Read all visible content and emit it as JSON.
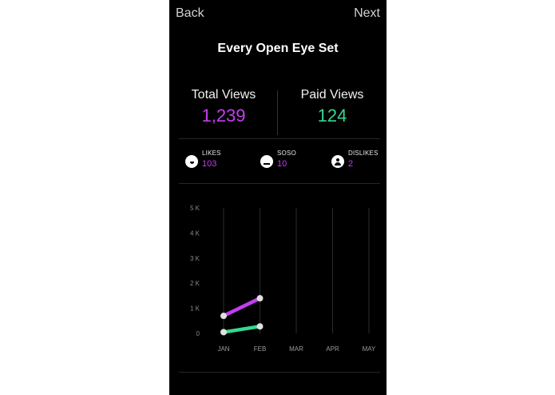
{
  "nav": {
    "back_label": "Back",
    "next_label": "Next"
  },
  "page": {
    "title": "Every Open Eye Set"
  },
  "stats": {
    "total_views_label": "Total Views",
    "total_views_value": "1,239",
    "paid_views_label": "Paid Views",
    "paid_views_value": "124"
  },
  "reactions": [
    {
      "label": "LIKES",
      "value": "103",
      "icon": "smile-face-icon"
    },
    {
      "label": "SOSO",
      "value": "10",
      "icon": "neutral-face-icon"
    },
    {
      "label": "DISLIKES",
      "value": "2",
      "icon": "person-face-icon"
    }
  ],
  "colors": {
    "purple": "#c33ef0",
    "green": "#35d88f",
    "background": "#000000"
  },
  "chart_data": {
    "type": "line",
    "categories": [
      "JAN",
      "FEB",
      "MAR",
      "APR",
      "MAY"
    ],
    "y_tick_labels": [
      "0",
      "1 K",
      "2 K",
      "3 K",
      "4 K",
      "5 K"
    ],
    "ylim": [
      0,
      5000
    ],
    "series": [
      {
        "color": "#c33ef0",
        "values": [
          700,
          1400,
          null,
          null,
          null
        ]
      },
      {
        "color": "#35d88f",
        "values": [
          50,
          280,
          null,
          null,
          null
        ]
      }
    ],
    "grid": "vertical"
  }
}
